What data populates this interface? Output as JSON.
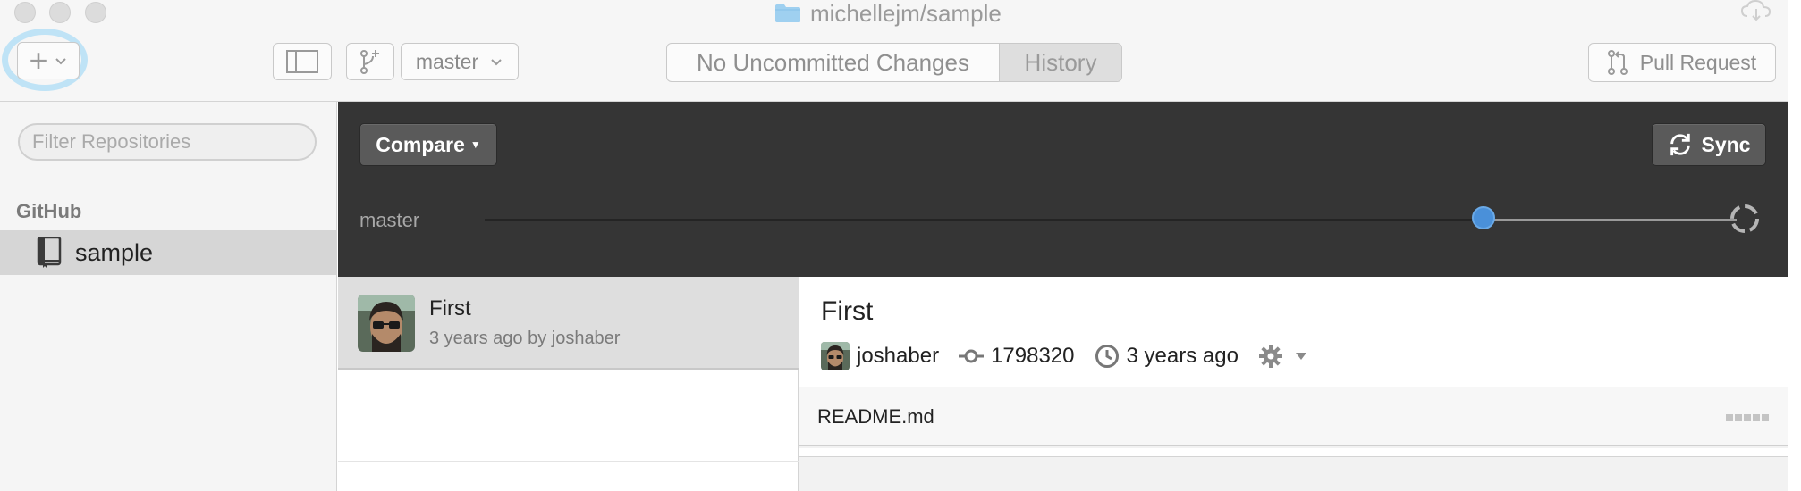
{
  "window": {
    "title": "michellejm/sample"
  },
  "toolbar": {
    "add_label": "+",
    "branch_selector": "master",
    "tabs": [
      {
        "label": "No Uncommitted Changes",
        "selected": false
      },
      {
        "label": "History",
        "selected": true
      }
    ],
    "pull_request_label": "Pull Request"
  },
  "sidebar": {
    "filter_placeholder": "Filter Repositories",
    "group_label": "GitHub",
    "repos": [
      {
        "name": "sample",
        "selected": true
      }
    ]
  },
  "history_header": {
    "compare_label": "Compare",
    "sync_label": "Sync",
    "branch_label": "master",
    "colors": {
      "timeline_dot": "#4a90d9",
      "header_bg": "#353535"
    }
  },
  "commits": [
    {
      "title": "First",
      "meta": "3 years ago by joshaber"
    }
  ],
  "commit_detail": {
    "title": "First",
    "author": "joshaber",
    "sha": "1798320",
    "time": "3 years ago",
    "files": [
      {
        "name": "README.md"
      }
    ]
  }
}
